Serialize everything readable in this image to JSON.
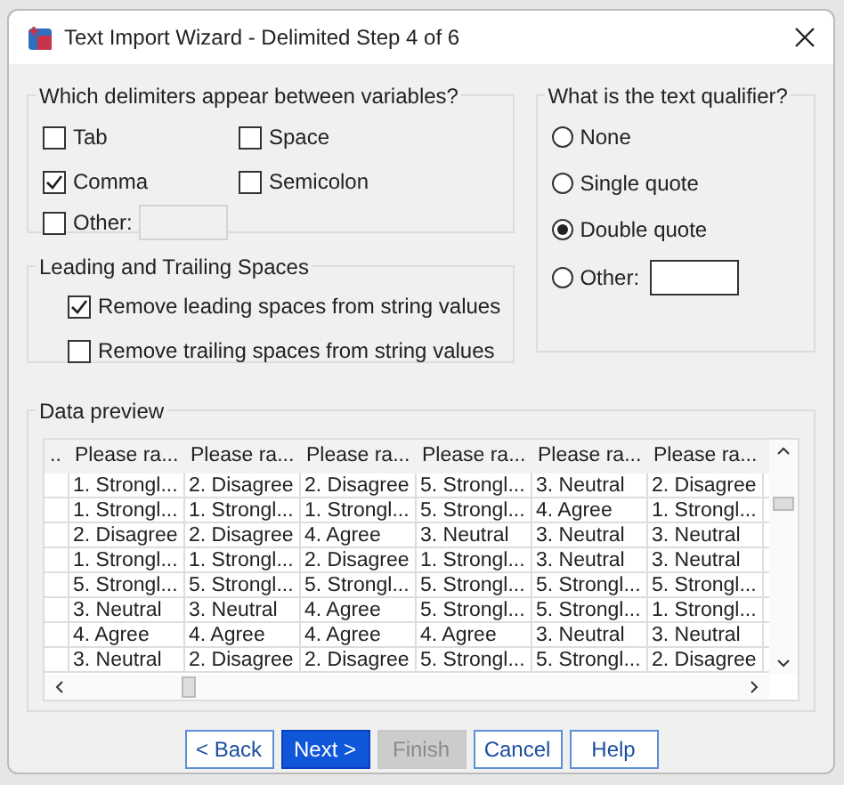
{
  "window": {
    "title": "Text Import Wizard - Delimited Step 4 of 6"
  },
  "delimiters": {
    "title": "Which delimiters appear between variables?",
    "items": [
      {
        "label": "Tab",
        "checked": false
      },
      {
        "label": "Space",
        "checked": false
      },
      {
        "label": "Comma",
        "checked": true
      },
      {
        "label": "Semicolon",
        "checked": false
      },
      {
        "label": "Other:",
        "checked": false
      }
    ]
  },
  "spaces": {
    "title": "Leading and Trailing Spaces",
    "items": [
      {
        "label": "Remove leading spaces from string values",
        "checked": true
      },
      {
        "label": "Remove trailing spaces from string values",
        "checked": false
      }
    ]
  },
  "qualifier": {
    "title": "What is the text qualifier?",
    "options": [
      {
        "label": "None",
        "selected": false
      },
      {
        "label": "Single quote",
        "selected": false
      },
      {
        "label": "Double quote",
        "selected": true
      },
      {
        "label": "Other:",
        "selected": false
      }
    ]
  },
  "preview": {
    "title": "Data preview",
    "columns": [
      "..",
      "Please ra...",
      "Please ra...",
      "Please ra...",
      "Please ra...",
      "Please ra...",
      "Please ra..."
    ],
    "rows": [
      [
        "",
        "1. Strongl...",
        "2. Disagree",
        "2. Disagree",
        "5. Strongl...",
        "3. Neutral",
        "2. Disagree"
      ],
      [
        "",
        "1. Strongl...",
        "1. Strongl...",
        "1. Strongl...",
        "5. Strongl...",
        "4. Agree",
        "1. Strongl..."
      ],
      [
        "",
        "2. Disagree",
        "2. Disagree",
        "4. Agree",
        "3. Neutral",
        "3. Neutral",
        "3. Neutral"
      ],
      [
        "",
        "1. Strongl...",
        "1. Strongl...",
        "2. Disagree",
        "1. Strongl...",
        "3. Neutral",
        "3. Neutral"
      ],
      [
        "",
        "5. Strongl...",
        "5. Strongl...",
        "5. Strongl...",
        "5. Strongl...",
        "5. Strongl...",
        "5. Strongl..."
      ],
      [
        "",
        "3. Neutral",
        "3. Neutral",
        "4. Agree",
        "5. Strongl...",
        "5. Strongl...",
        "1. Strongl..."
      ],
      [
        "",
        "4. Agree",
        "4. Agree",
        "4. Agree",
        "4. Agree",
        "3. Neutral",
        "3. Neutral"
      ],
      [
        "",
        "3. Neutral",
        "2. Disagree",
        "2. Disagree",
        "5. Strongl...",
        "5. Strongl...",
        "2. Disagree"
      ]
    ]
  },
  "buttons": [
    {
      "label": "< Back",
      "kind": "normal"
    },
    {
      "label": "Next >",
      "kind": "default"
    },
    {
      "label": "Finish",
      "kind": "disabled"
    },
    {
      "label": "Cancel",
      "kind": "normal"
    },
    {
      "label": "Help",
      "kind": "normal"
    }
  ]
}
